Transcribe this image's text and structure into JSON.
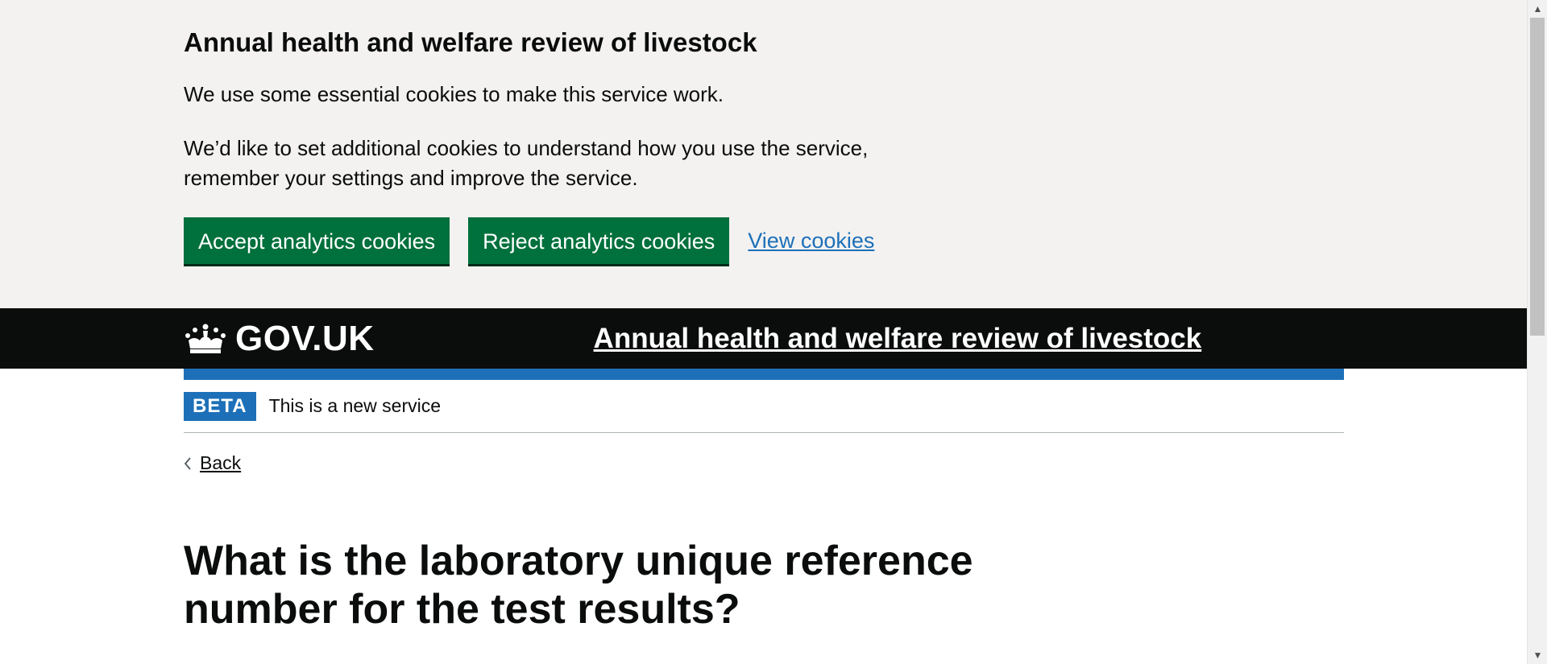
{
  "cookie_banner": {
    "heading": "Annual health and welfare review of livestock",
    "text_essential": "We use some essential cookies to make this service work.",
    "text_additional": "We’d like to set additional cookies to understand how you use the service, remember your settings and improve the service.",
    "accept_label": "Accept analytics cookies",
    "reject_label": "Reject analytics cookies",
    "view_label": "View cookies"
  },
  "header": {
    "logo_text": "GOV.UK",
    "service_name": "Annual health and welfare review of livestock"
  },
  "phase_banner": {
    "tag": "BETA",
    "text": "This is a new service"
  },
  "navigation": {
    "back_label": "Back"
  },
  "main": {
    "heading": "What is the laboratory unique reference number for the test results?"
  },
  "colors": {
    "button_green": "#00703c",
    "link_blue": "#1d70b8",
    "header_black": "#0b0c0c",
    "banner_grey": "#f3f2f1"
  },
  "icons": [
    "crown-icon",
    "chevron-left-icon",
    "scroll-up-icon",
    "scroll-down-icon"
  ]
}
